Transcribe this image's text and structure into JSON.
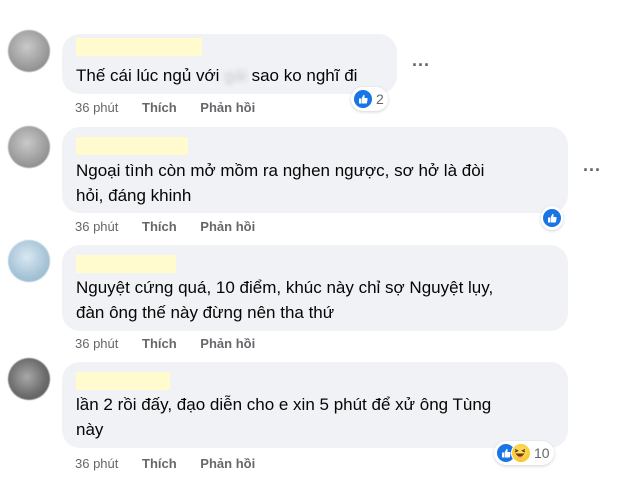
{
  "comments": [
    {
      "text_before": "Thế cái lúc ngủ với ",
      "blurred": "gái",
      "text_after": " sao ko nghĩ đi",
      "time": "36 phút",
      "like": "Thích",
      "reply": "Phản hồi",
      "reaction_count": "2"
    },
    {
      "text": "Ngoại tình còn mở mồm ra nghen ngược, sơ hở là đòi\nhỏi, đáng khinh",
      "time": "36 phút",
      "like": "Thích",
      "reply": "Phản hồi"
    },
    {
      "text": "Nguyệt cứng quá, 10 điểm, khúc này chỉ sợ Nguyệt lụy,\nđàn ông thế này đừng nên tha thứ",
      "time": "36 phút",
      "like": "Thích",
      "reply": "Phản hồi"
    },
    {
      "text": "lần 2 rồi đấy, đạo diễn cho e xin 5 phút để xử ông Tùng\nnày",
      "time": "36 phút",
      "like": "Thích",
      "reply": "Phản hồi",
      "reaction_count": "10"
    }
  ],
  "more_label": "...",
  "icons": [
    "like-icon",
    "haha-icon",
    "more-options-icon"
  ],
  "colors": {
    "bubble": "#f0f2f5",
    "meta_text": "#65676b",
    "like_blue": "#1b74e4",
    "name_redaction": "#fffbcf"
  }
}
